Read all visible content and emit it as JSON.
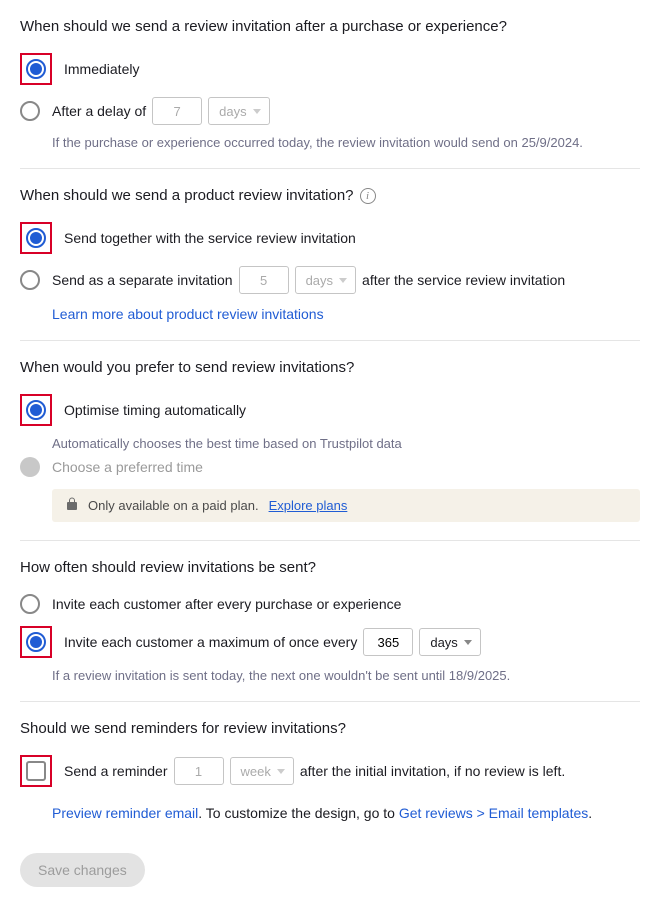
{
  "section1": {
    "question": "When should we send a review invitation after a purchase or experience?",
    "opt1": "Immediately",
    "opt2_prefix": "After a delay of",
    "opt2_value": "7",
    "opt2_unit": "days",
    "hint": "If the purchase or experience occurred today, the review invitation would send on 25/9/2024."
  },
  "section2": {
    "question": "When should we send a product review invitation?",
    "opt1": "Send together with the service review invitation",
    "opt2_prefix": "Send as a separate invitation",
    "opt2_value": "5",
    "opt2_unit": "days",
    "opt2_suffix": "after the service review invitation",
    "link": "Learn more about product review invitations"
  },
  "section3": {
    "question": "When would you prefer to send review invitations?",
    "opt1": "Optimise timing automatically",
    "opt1_hint": "Automatically chooses the best time based on Trustpilot data",
    "opt2": "Choose a preferred time",
    "paid_msg": "Only available on a paid plan.",
    "paid_link": "Explore plans"
  },
  "section4": {
    "question": "How often should review invitations be sent?",
    "opt1": "Invite each customer after every purchase or experience",
    "opt2_prefix": "Invite each customer a maximum of once every",
    "opt2_value": "365",
    "opt2_unit": "days",
    "hint": "If a review invitation is sent today, the next one wouldn't be sent until 18/9/2025."
  },
  "section5": {
    "question": "Should we send reminders for review invitations?",
    "opt1_prefix": "Send a reminder",
    "opt1_value": "1",
    "opt1_unit": "week",
    "opt1_suffix": "after the initial invitation, if no review is left.",
    "link1": "Preview reminder email",
    "mid": ". To customize the design, go to ",
    "link2": "Get reviews > Email templates",
    "tail": "."
  },
  "save": "Save changes"
}
